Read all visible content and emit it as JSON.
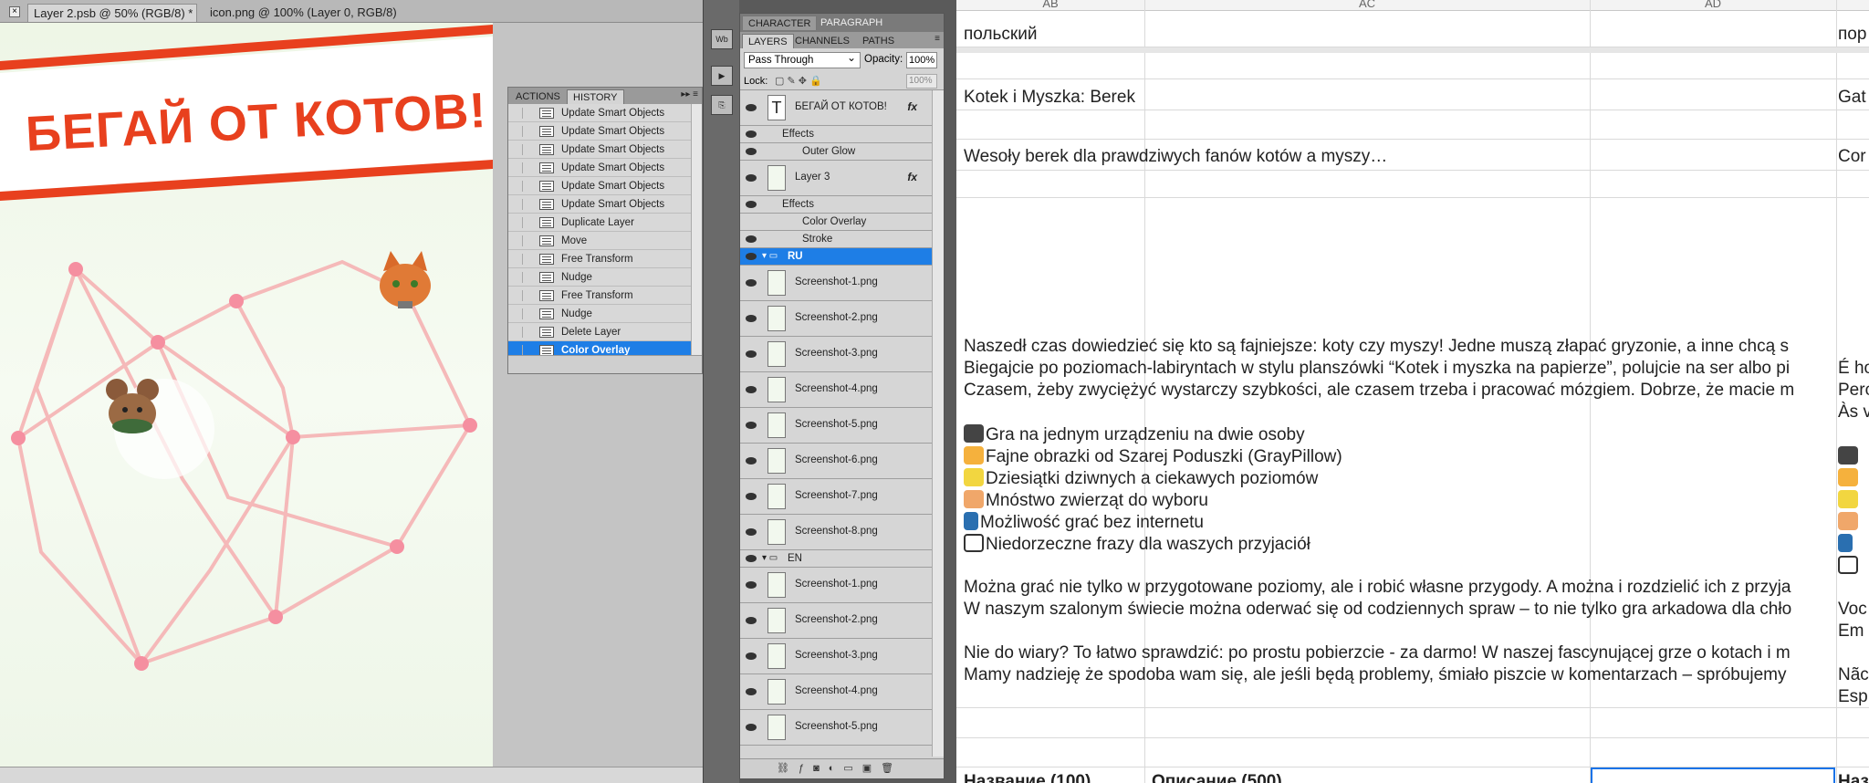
{
  "photoshop": {
    "doc_tabs": [
      {
        "label": "Layer 2.psb @ 50% (RGB/8) *"
      },
      {
        "label": "icon.png @ 100% (Layer 0, RGB/8)"
      }
    ],
    "canvas_banner": "БЕГАЙ ОТ КОТОВ!",
    "history_panel": {
      "tabs": [
        "ACTIONS",
        "HISTORY"
      ],
      "items": [
        "Update Smart Objects",
        "Update Smart Objects",
        "Update Smart Objects",
        "Update Smart Objects",
        "Update Smart Objects",
        "Update Smart Objects",
        "Duplicate Layer",
        "Move",
        "Free Transform",
        "Nudge",
        "Free Transform",
        "Nudge",
        "Delete Layer",
        "Color Overlay"
      ],
      "selected": "Color Overlay"
    },
    "layers_panel": {
      "top_tabs": [
        "CHARACTER",
        "PARAGRAPH"
      ],
      "tabs": [
        "LAYERS",
        "CHANNELS",
        "PATHS"
      ],
      "blend_mode": "Pass Through",
      "opacity_label": "Opacity:",
      "opacity": "100%",
      "lock_label": "Lock:",
      "fill": "100%",
      "fx_label": "fx",
      "layers": [
        {
          "name": "БЕГАЙ ОТ КОТОВ!",
          "kind": "text"
        },
        {
          "name": "Effects",
          "kind": "effects"
        },
        {
          "name": "Outer Glow",
          "kind": "effect"
        },
        {
          "name": "Layer 3",
          "kind": "layer"
        },
        {
          "name": "Effects",
          "kind": "effects"
        },
        {
          "name": "Color Overlay",
          "kind": "effect"
        },
        {
          "name": "Stroke",
          "kind": "effect"
        },
        {
          "name": "RU",
          "kind": "group"
        },
        {
          "name": "Screenshot-1.png",
          "kind": "layer"
        },
        {
          "name": "Screenshot-2.png",
          "kind": "layer"
        },
        {
          "name": "Screenshot-3.png",
          "kind": "layer"
        },
        {
          "name": "Screenshot-4.png",
          "kind": "layer"
        },
        {
          "name": "Screenshot-5.png",
          "kind": "layer"
        },
        {
          "name": "Screenshot-6.png",
          "kind": "layer"
        },
        {
          "name": "Screenshot-7.png",
          "kind": "layer"
        },
        {
          "name": "Screenshot-8.png",
          "kind": "layer"
        },
        {
          "name": "EN",
          "kind": "group"
        },
        {
          "name": "Screenshot-1.png",
          "kind": "layer"
        },
        {
          "name": "Screenshot-2.png",
          "kind": "layer"
        },
        {
          "name": "Screenshot-3.png",
          "kind": "layer"
        },
        {
          "name": "Screenshot-4.png",
          "kind": "layer"
        },
        {
          "name": "Screenshot-5.png",
          "kind": "layer"
        }
      ]
    }
  },
  "spreadsheet": {
    "columns": [
      "AB",
      "AC",
      "AD"
    ],
    "row_language": {
      "AB": "польский",
      "AE": "пор"
    },
    "row_title": {
      "AB": "Kotek i Myszka: Berek",
      "AE": "Gat"
    },
    "row_short": {
      "AB": "Wesoły berek dla prawdziwych fanów kotów a myszy…",
      "AE": "Cor"
    },
    "description_lines": [
      "Naszedł czas dowiedzieć się kto są fajniejsze: koty czy myszy! Jedne  muszą złapać gryzonie, a inne chcą s",
      "Biegajcie po poziomach-labiryntach w stylu planszówki “Kotek i myszka na papierze”, polujcie na ser albo pi",
      "Czasem, żeby zwyciężyć wystarczy szybkości, ale czasem trzeba i pracować mózgiem. Dobrze, że macie m"
    ],
    "features": [
      {
        "icon": "people-icon",
        "text": "Gra na jednym urządzeniu na dwie osoby"
      },
      {
        "icon": "cat-face-icon",
        "text": "Fajne obrazki od Szarej Poduszki (GrayPillow)"
      },
      {
        "icon": "sparkle-icon",
        "text": "Dziesiątki dziwnych a ciekawych poziomów"
      },
      {
        "icon": "hamster-icon",
        "text": "Mnóstwo zwierząt do wyboru"
      },
      {
        "icon": "phone-icon",
        "text": "Możliwość grać bez internetu"
      },
      {
        "icon": "speech-bubble-icon",
        "text": "Niedorzeczne frazy dla waszych przyjaciół"
      }
    ],
    "description_lines_2": [
      "Można grać nie tylko w przygotowane poziomy, ale i robić własne przygody. A można i rozdzielić ich z przyja",
      "W naszym szalonym świecie można oderwać się od codziennych spraw – to nie tylko gra arkadowa dla chło"
    ],
    "description_lines_3": [
      "Nie do wiary? To łatwo sprawdzić: po prostu pobierzcie  - za darmo! W naszej fascynującej grze o kotach i m",
      "Mamy nadzieję że spodoba wam się, ale jeśli będą problemy, śmiało piszcie w komentarzach – spróbujemy"
    ],
    "ae_snippets": [
      "É ho",
      "Perc",
      "Às v",
      "Voc",
      "Em",
      "Nãc",
      "Esp"
    ],
    "bottom_row": {
      "AB": "Название (100)",
      "AC": "Описание (500)",
      "AE": "Наз"
    }
  }
}
